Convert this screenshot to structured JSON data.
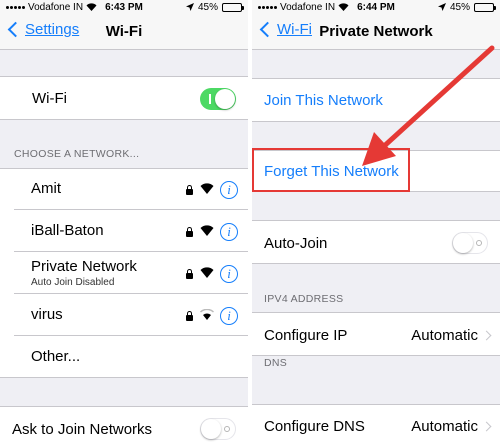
{
  "left": {
    "status": {
      "carrier": "Vodafone IN",
      "time": "6:43 PM",
      "battery": "45%",
      "battery_level": 0.45
    },
    "nav": {
      "back_label": "Settings",
      "title": "Wi-Fi"
    },
    "wifi_row": {
      "label": "Wi-Fi",
      "enabled": true
    },
    "section_header": "CHOOSE A NETWORK...",
    "networks": [
      {
        "name": "Amit",
        "subtitle": "",
        "secured": true
      },
      {
        "name": "iBall-Baton",
        "subtitle": "",
        "secured": true
      },
      {
        "name": "Private Network",
        "subtitle": "Auto Join Disabled",
        "secured": true
      },
      {
        "name": "virus",
        "subtitle": "",
        "secured": true
      }
    ],
    "other_label": "Other...",
    "ask_to_join": {
      "label": "Ask to Join Networks",
      "enabled": false
    }
  },
  "right": {
    "status": {
      "carrier": "Vodafone IN",
      "time": "6:44 PM",
      "battery": "45%",
      "battery_level": 0.45
    },
    "nav": {
      "back_label": "Wi-Fi",
      "title": "Private Network"
    },
    "join_label": "Join This Network",
    "forget_label": "Forget This Network",
    "auto_join": {
      "label": "Auto-Join",
      "enabled": false
    },
    "ipv4_header": "IPV4 ADDRESS",
    "configure_ip": {
      "label": "Configure IP",
      "value": "Automatic"
    },
    "dns_header": "DNS",
    "configure_dns": {
      "label": "Configure DNS",
      "value": "Automatic"
    }
  },
  "colors": {
    "accent": "#157efb",
    "toggle_on": "#4cd964",
    "annotation": "#e53935",
    "background": "#efeff4"
  }
}
